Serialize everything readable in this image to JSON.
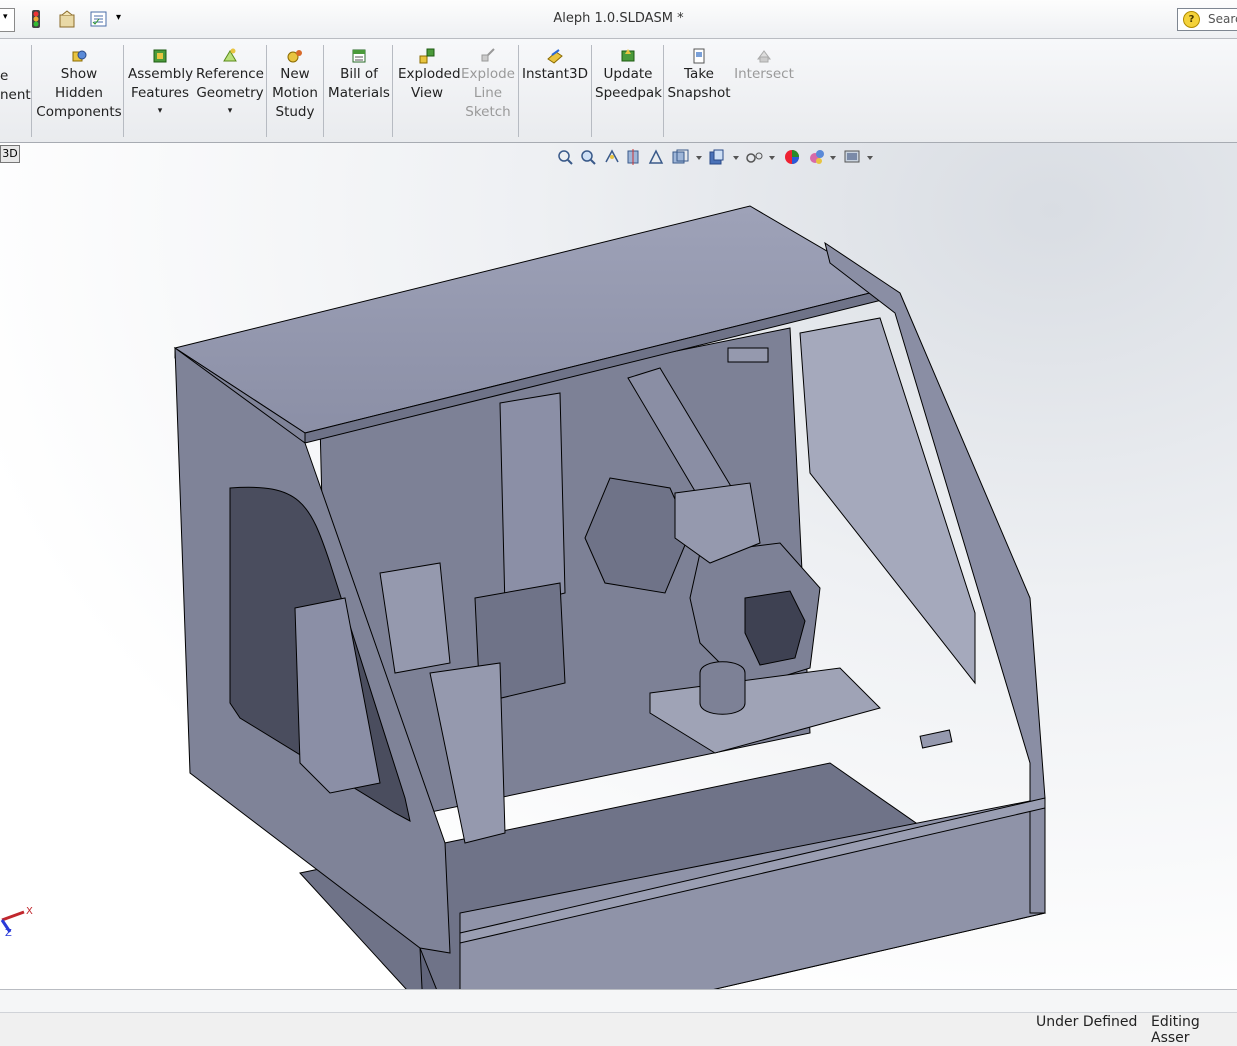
{
  "window": {
    "title": "Aleph 1.0.SLDASM *"
  },
  "search": {
    "label": "Searc"
  },
  "ribbon": {
    "partial_left": [
      "e",
      "nent"
    ],
    "show_hidden": "Show Hidden Components",
    "assembly_features": "Assembly Features",
    "reference_geometry": "Reference Geometry",
    "new_motion_study": "New Motion Study",
    "bill_of_materials": "Bill of Materials",
    "exploded_view": "Exploded View",
    "explode_line_sketch": "Explode Line Sketch",
    "instant3d": "Instant3D",
    "update_speedpak": "Update Speedpak",
    "take_snapshot": "Take Snapshot",
    "intersect": "Intersect",
    "dropdown_glyph": "▾"
  },
  "viewport": {
    "tag": "3D",
    "triad_x": "X",
    "triad_z": "Z"
  },
  "status": {
    "under_defined": "Under Defined",
    "editing": "Editing Asser"
  }
}
